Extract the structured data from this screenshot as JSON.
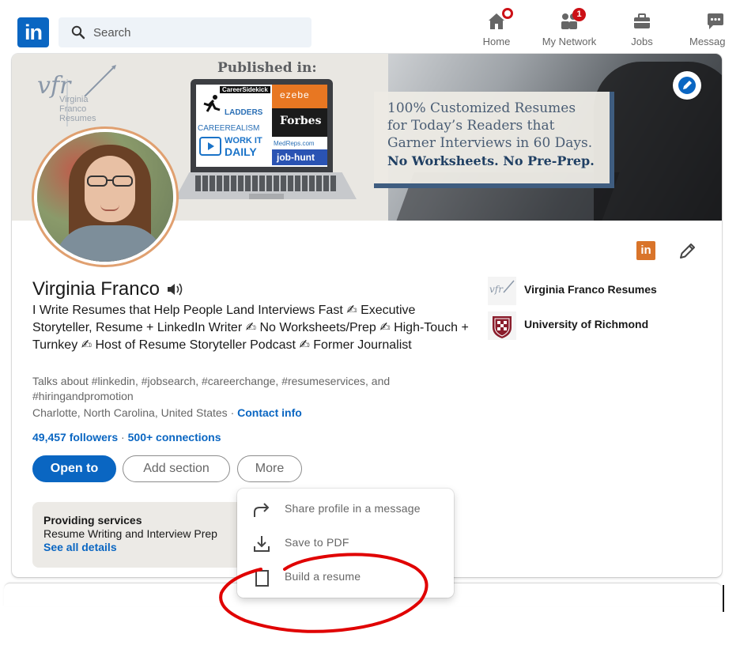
{
  "nav": {
    "logo": "in",
    "search_placeholder": "Search",
    "items": [
      {
        "label": "Home",
        "icon": "home-icon"
      },
      {
        "label": "My Network",
        "icon": "network-icon",
        "badge": "1"
      },
      {
        "label": "Jobs",
        "icon": "briefcase-icon"
      },
      {
        "label": "Messag",
        "icon": "message-icon"
      }
    ]
  },
  "banner": {
    "published_in": "Published in:",
    "tagline_lines": [
      "100% Customized Resumes",
      "for Today’s Readers that",
      "Garner Interviews in 60 Days."
    ],
    "tagline_bold": "No Worksheets. No Pre-Prep.",
    "logo_text": "vfr",
    "logo_sub": [
      "Virginia",
      "Franco",
      "Resumes"
    ],
    "publications": [
      "CareerSidekick",
      "LADDERS",
      "CAREEREALISM",
      "WORK IT",
      "DAILY",
      "ezebe",
      "Forbes",
      "MedReps.com",
      "job-hunt"
    ]
  },
  "profile": {
    "name": "Virginia Franco",
    "headline": "I Write Resumes that Help People Land Interviews Fast ✍ Executive Storyteller, Resume + LinkedIn Writer ✍ No Worksheets/Prep ✍ High-Touch + Turnkey ✍ Host of Resume Storyteller Podcast ✍ Former Journalist",
    "talks": "Talks about #linkedin, #jobsearch, #careerchange, #resumeservices, and #hiringandpromotion",
    "location": "Charlotte, North Carolina, United States",
    "location_sep": " · ",
    "contact": "Contact info",
    "followers": "49,457 followers",
    "connections_sep": " · ",
    "connections": "500+ connections"
  },
  "actions": {
    "open_to": "Open to",
    "add_section": "Add section",
    "more": "More"
  },
  "services": {
    "title": "Providing services",
    "desc": "Resume Writing and Interview Prep",
    "link": "See all details"
  },
  "side": [
    {
      "label": "Virginia Franco Resumes",
      "icon": "company-logo"
    },
    {
      "label": "University of Richmond",
      "icon": "university-logo"
    }
  ],
  "menu": [
    {
      "label": "Share profile in a message",
      "icon": "share-arrow-icon"
    },
    {
      "label": "Save to PDF",
      "icon": "download-icon"
    },
    {
      "label": "Build a resume",
      "icon": "document-icon"
    }
  ],
  "colors": {
    "brand": "#0a66c2",
    "annotation": "#e00000",
    "badge": "#cc1016"
  }
}
